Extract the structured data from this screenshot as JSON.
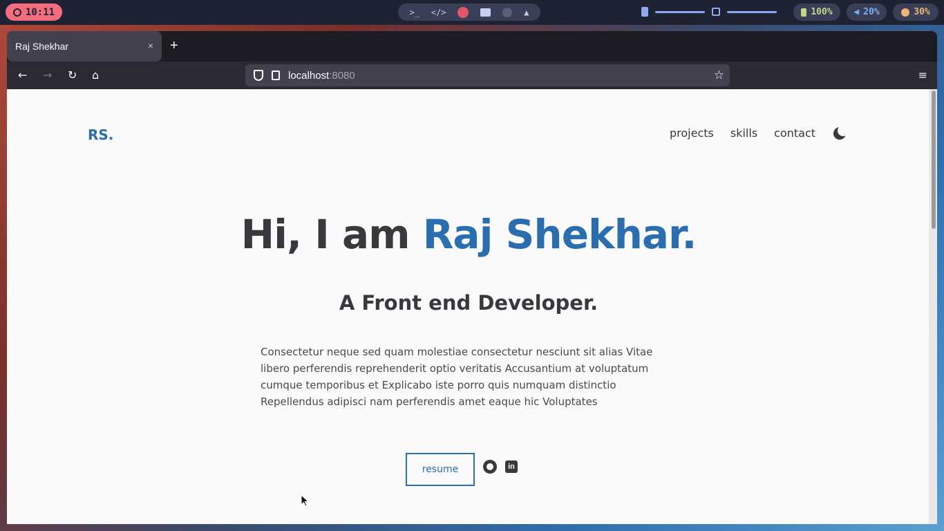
{
  "topbar": {
    "time": "10:11",
    "dock_icons": [
      "terminal-icon",
      "code-icon",
      "firefox-icon",
      "folder-icon",
      "media-icon",
      "arch-icon"
    ],
    "terminal_glyph": ">_",
    "code_glyph": "</>",
    "battery": "100%",
    "volume": "20%",
    "brightness": "30%"
  },
  "browser": {
    "tab_title": "Raj Shekhar",
    "tab_close": "×",
    "new_tab": "+",
    "url_host": "localhost",
    "url_port": ":8080"
  },
  "page": {
    "logo": "RS.",
    "nav": [
      "projects",
      "skills",
      "contact"
    ],
    "hero_prefix": "Hi, I am ",
    "hero_name": "Raj Shekhar.",
    "subtitle": "A Front end Developer.",
    "description": "Consectetur neque sed quam molestiae consectetur nesciunt sit alias Vitae libero perferendis reprehenderit optio veritatis Accusantium at voluptatum cumque temporibus et Explicabo iste porro quis numquam distinctio Repellendus adipisci nam perferendis amet eaque hic Voluptates",
    "resume_label": "resume",
    "linkedin_glyph": "in"
  },
  "colors": {
    "accent": "#2a6eb0",
    "text": "#3a383c",
    "clock_bg": "#f26d7d"
  }
}
